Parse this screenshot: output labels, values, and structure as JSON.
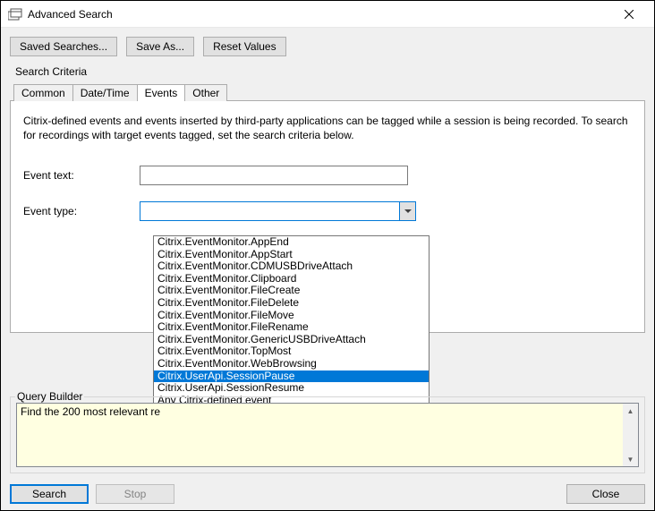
{
  "window": {
    "title": "Advanced Search",
    "close_label": "Close"
  },
  "toolbar": {
    "saved_searches": "Saved Searches...",
    "save_as": "Save As...",
    "reset_values": "Reset Values"
  },
  "section_title": "Search Criteria",
  "tabs": {
    "common": "Common",
    "datetime": "Date/Time",
    "events": "Events",
    "other": "Other"
  },
  "events_panel": {
    "description": "Citrix-defined events and events inserted by third-party applications can be tagged while a session is being recorded. To search for recordings with target events tagged, set the search criteria below.",
    "event_text_label": "Event text:",
    "event_type_label": "Event type:"
  },
  "event_type_dropdown": {
    "items": {
      "0": "Citrix.EventMonitor.AppEnd",
      "1": "Citrix.EventMonitor.AppStart",
      "2": "Citrix.EventMonitor.CDMUSBDriveAttach",
      "3": "Citrix.EventMonitor.Clipboard",
      "4": "Citrix.EventMonitor.FileCreate",
      "5": "Citrix.EventMonitor.FileDelete",
      "6": "Citrix.EventMonitor.FileMove",
      "7": "Citrix.EventMonitor.FileRename",
      "8": "Citrix.EventMonitor.GenericUSBDriveAttach",
      "9": "Citrix.EventMonitor.TopMost",
      "10": "Citrix.EventMonitor.WebBrowsing",
      "11": "Citrix.UserApi.SessionPause",
      "12": "Citrix.UserApi.SessionResume",
      "13": "Any Citrix-defined event"
    },
    "selected_index": 11
  },
  "query_builder": {
    "title": "Query Builder",
    "text": "Find the 200 most relevant re"
  },
  "footer": {
    "search": "Search",
    "stop": "Stop",
    "close": "Close"
  }
}
